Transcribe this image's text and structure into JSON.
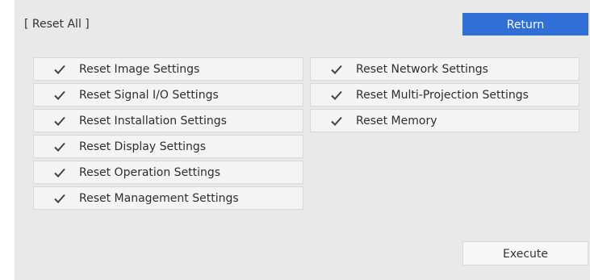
{
  "header": {
    "title": "[ Reset All ]",
    "return_label": "Return"
  },
  "left_items": [
    {
      "label": "Reset Image Settings",
      "checked": true
    },
    {
      "label": "Reset Signal I/O Settings",
      "checked": true
    },
    {
      "label": "Reset Installation Settings",
      "checked": true
    },
    {
      "label": "Reset Display Settings",
      "checked": true
    },
    {
      "label": "Reset Operation Settings",
      "checked": true
    },
    {
      "label": "Reset Management Settings",
      "checked": true
    }
  ],
  "right_items": [
    {
      "label": "Reset Network Settings",
      "checked": true
    },
    {
      "label": "Reset Multi-Projection Settings",
      "checked": true
    },
    {
      "label": "Reset Memory",
      "checked": true
    }
  ],
  "footer": {
    "execute_label": "Execute"
  },
  "colors": {
    "accent": "#2f6fd6",
    "panel": "#e9e9ea",
    "item": "#f4f4f5"
  },
  "icons": {
    "check": "checkmark-icon"
  }
}
